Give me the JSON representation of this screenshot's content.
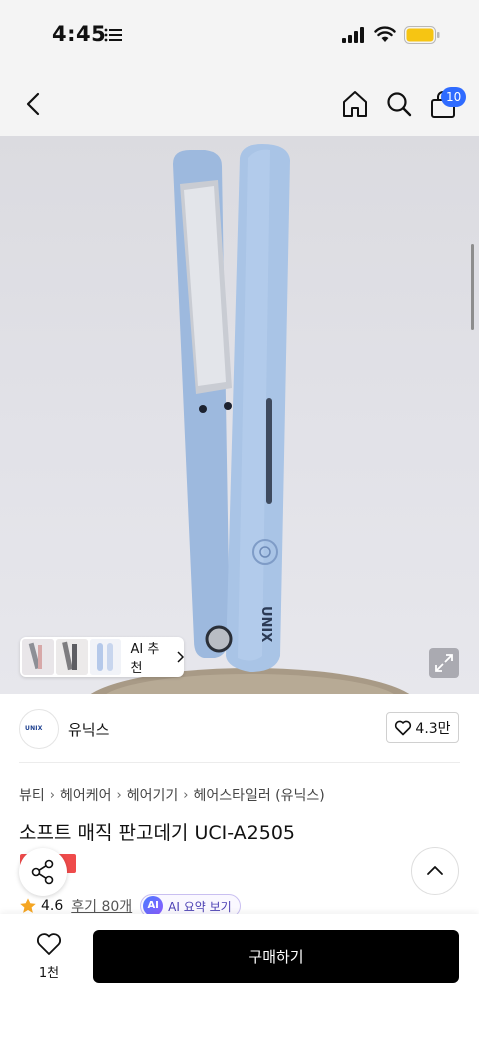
{
  "status_bar": {
    "time": "4:45",
    "icons": [
      "list-icon",
      "signal-icon",
      "wifi-icon",
      "battery-icon"
    ]
  },
  "header": {
    "icons": [
      "back-icon",
      "home-icon",
      "search-icon",
      "cart-icon"
    ],
    "cart_count": "10"
  },
  "hero": {
    "brand_mark": "UNIX",
    "ai_recommend_label": "AI 추천"
  },
  "brand": {
    "logo_text": "UNIX",
    "name": "유닉스",
    "likes": "4.3만"
  },
  "breadcrumb": [
    "뷰티",
    "헤어케어",
    "헤어기기",
    "헤어스타일러 (유닉스)"
  ],
  "product": {
    "title": "소프트 매직 판고데기 UCI-A2505",
    "rating": "4.6",
    "reviews": "후기 80개",
    "ai_badge": "AI",
    "ai_summary": "AI 요약 보기"
  },
  "bottom_bar": {
    "wish_count": "1천",
    "buy_label": "구매하기"
  },
  "colors": {
    "accent_blue": "#2f6bff",
    "buy_button": "#000000",
    "badge_red": "#ef4b4b",
    "star": "#f5a623",
    "product_body": "#a9c4e6"
  }
}
